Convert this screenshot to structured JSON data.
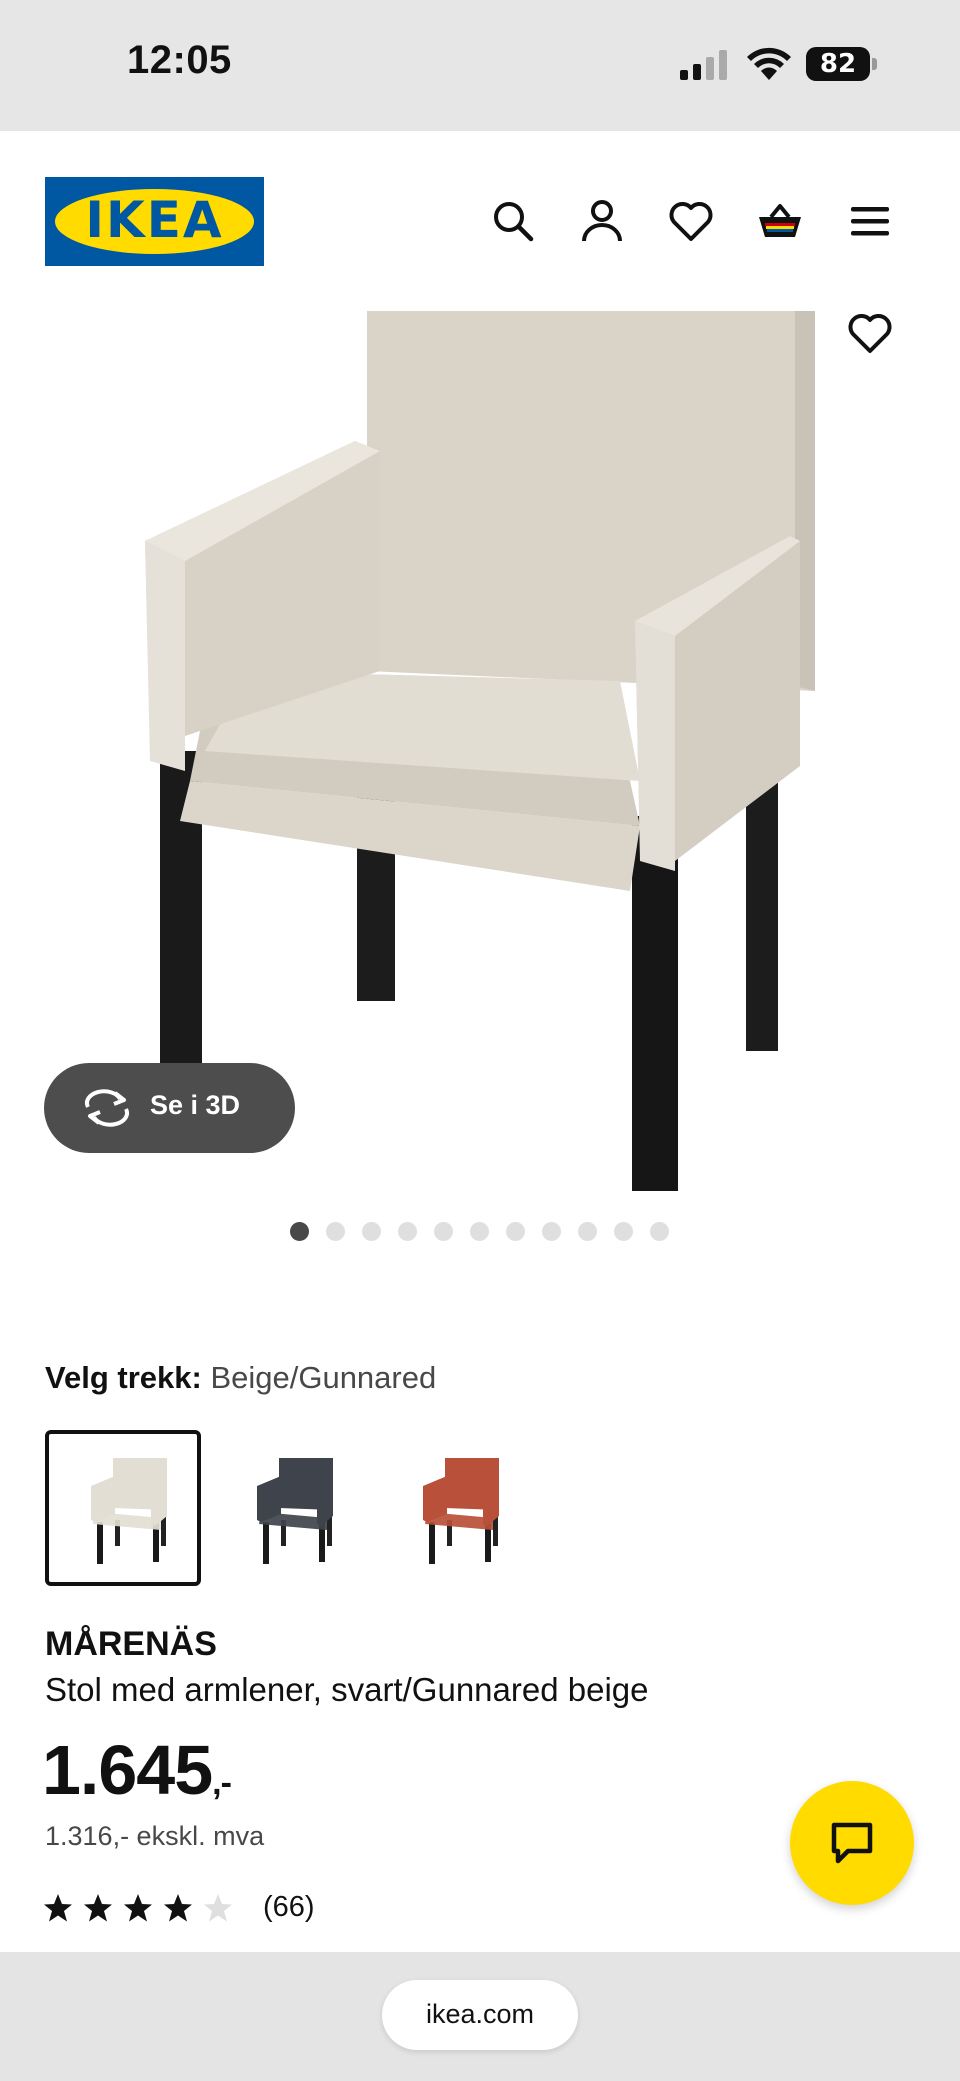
{
  "status_bar": {
    "time": "12:05",
    "battery": "82"
  },
  "header": {
    "logo_text": "IKEA",
    "icons": [
      "search-icon",
      "account-icon",
      "favorites-icon",
      "shopping-bag-icon",
      "menu-icon"
    ]
  },
  "gallery": {
    "view_3d_label": "Se i 3D",
    "image_count": 11,
    "active_index": 0
  },
  "cover": {
    "label": "Velg trekk:",
    "value": "Beige/Gunnared",
    "options": [
      {
        "name": "beige",
        "color": "#e3ded4",
        "selected": true
      },
      {
        "name": "dark-grey",
        "color": "#3f434b",
        "selected": false
      },
      {
        "name": "red-orange",
        "color": "#b8503a",
        "selected": false
      }
    ]
  },
  "product": {
    "name": "MÅRENÄS",
    "description": "Stol med armlener, svart/Gunnared beige",
    "price": "1.645",
    "price_suffix": ",-",
    "price_ex_vat": "1.316,- ekskl. mva",
    "rating": 4,
    "rating_max": 5,
    "review_count": "(66)"
  },
  "browser": {
    "url": "ikea.com"
  },
  "colors": {
    "ikea_blue": "#0058a3",
    "ikea_yellow": "#ffdb00",
    "text": "#111111",
    "secondary_text": "#484848"
  }
}
